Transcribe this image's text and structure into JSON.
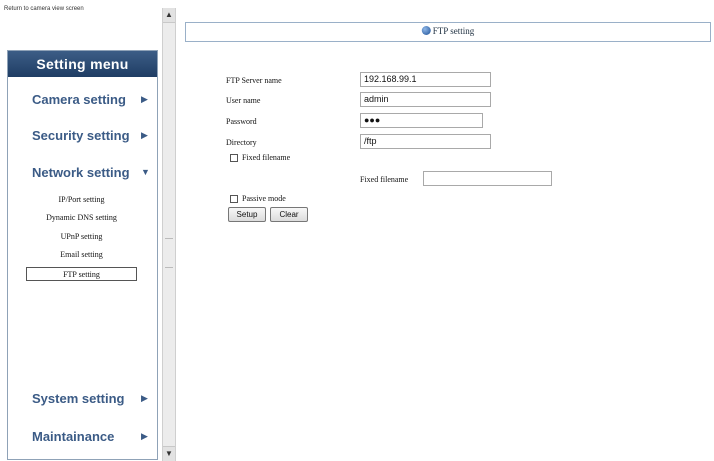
{
  "breadcrumb": "Return to camera view screen",
  "scrollbar": {
    "up": "▲",
    "down": "▼"
  },
  "sidebar": {
    "header": "Setting menu",
    "items": [
      {
        "label": "Camera setting",
        "arrow": "▶"
      },
      {
        "label": "Security setting",
        "arrow": "▶"
      },
      {
        "label": "Network setting",
        "arrow": "▼"
      },
      {
        "label": "System setting",
        "arrow": "▶"
      },
      {
        "label": "Maintainance",
        "arrow": "▶"
      }
    ],
    "subitems": [
      {
        "label": "IP/Port setting"
      },
      {
        "label": "Dynamic DNS setting"
      },
      {
        "label": "UPnP setting"
      },
      {
        "label": "Email setting"
      },
      {
        "label": "FTP setting",
        "active": true
      }
    ]
  },
  "main": {
    "title": "FTP setting",
    "labels": {
      "server": "FTP Server name",
      "user": "User name",
      "password": "Password",
      "directory": "Directory",
      "fixed_filename_cb": "Fixed filename",
      "fixed_filename_field": "Fixed filename",
      "passive_cb": "Passive mode"
    },
    "values": {
      "server": "192.168.99.1",
      "user": "admin",
      "password": "●●●",
      "directory": "/ftp",
      "fixed_filename": ""
    },
    "checkboxes": {
      "fixed_filename": false,
      "passive_mode": false
    },
    "buttons": {
      "setup": "Setup",
      "clear": "Clear"
    }
  },
  "colors": {
    "header_bg": "#1f3d64",
    "menu_text": "#3b5b86",
    "panel_border": "#9ab0c8"
  }
}
